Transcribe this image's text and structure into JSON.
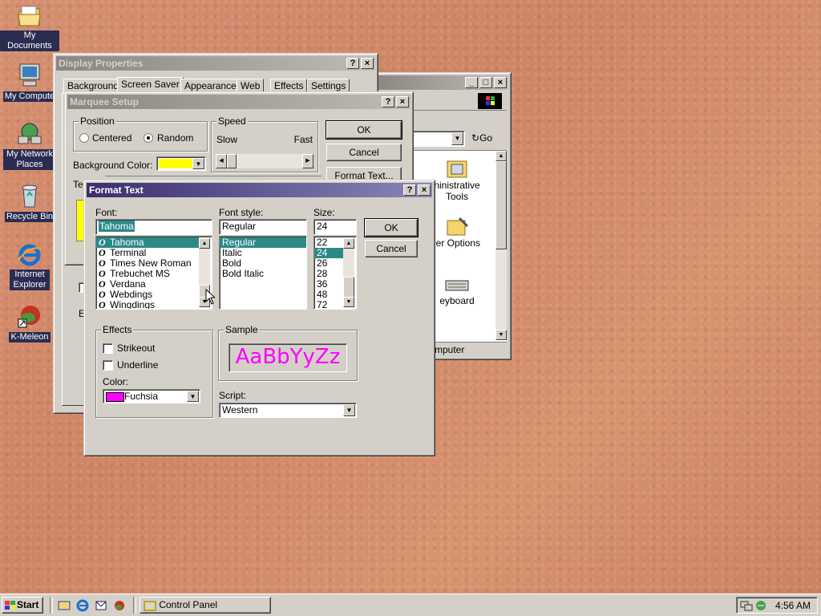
{
  "desktop": {
    "icons": [
      {
        "label": "My Documents"
      },
      {
        "label": "My Compute"
      },
      {
        "label": "My Network Places"
      },
      {
        "label": "Recycle Bin"
      },
      {
        "label": "Internet Explorer"
      },
      {
        "label": "K-Meleon"
      }
    ]
  },
  "control_panel": {
    "go_label": "Go",
    "items": [
      {
        "label": "ninistrative Tools"
      },
      {
        "label": "ler Options"
      },
      {
        "label": "eyboard"
      }
    ],
    "status": "mputer"
  },
  "display_properties": {
    "title": "Display Properties",
    "tabs": [
      "Background",
      "Screen Saver",
      "Appearance",
      "Web",
      "Effects",
      "Settings"
    ]
  },
  "marquee_setup": {
    "title": "Marquee Setup",
    "position_label": "Position",
    "centered_label": "Centered",
    "random_label": "Random",
    "speed_label": "Speed",
    "slow_label": "Slow",
    "fast_label": "Fast",
    "bg_color_label": "Background Color:",
    "bg_color": "#ffff00",
    "te_label": "Te",
    "ok_label": "OK",
    "cancel_label": "Cancel",
    "format_text_label": "Format Text..."
  },
  "format_text": {
    "title": "Format Text",
    "font_label": "Font:",
    "font_value": "Tahoma",
    "fonts": [
      "Tahoma",
      "Terminal",
      "Times New Roman",
      "Trebuchet MS",
      "Verdana",
      "Webdings",
      "Wingdings"
    ],
    "selected_font": 0,
    "style_label": "Font style:",
    "style_value": "Regular",
    "styles": [
      "Regular",
      "Italic",
      "Bold",
      "Bold Italic"
    ],
    "selected_style": 0,
    "size_label": "Size:",
    "size_value": "24",
    "sizes": [
      "22",
      "24",
      "26",
      "28",
      "36",
      "48",
      "72"
    ],
    "selected_size": 1,
    "ok_label": "OK",
    "cancel_label": "Cancel",
    "effects_label": "Effects",
    "strikeout_label": "Strikeout",
    "underline_label": "Underline",
    "color_label": "Color:",
    "color_value": "Fuchsia",
    "color_hex": "#ff00ff",
    "sample_label": "Sample",
    "sample_text": "AaBbYyZz",
    "script_label": "Script:",
    "script_value": "Western"
  },
  "taskbar": {
    "start_label": "Start",
    "task_label": "Control Panel",
    "clock": "4:56 AM"
  }
}
